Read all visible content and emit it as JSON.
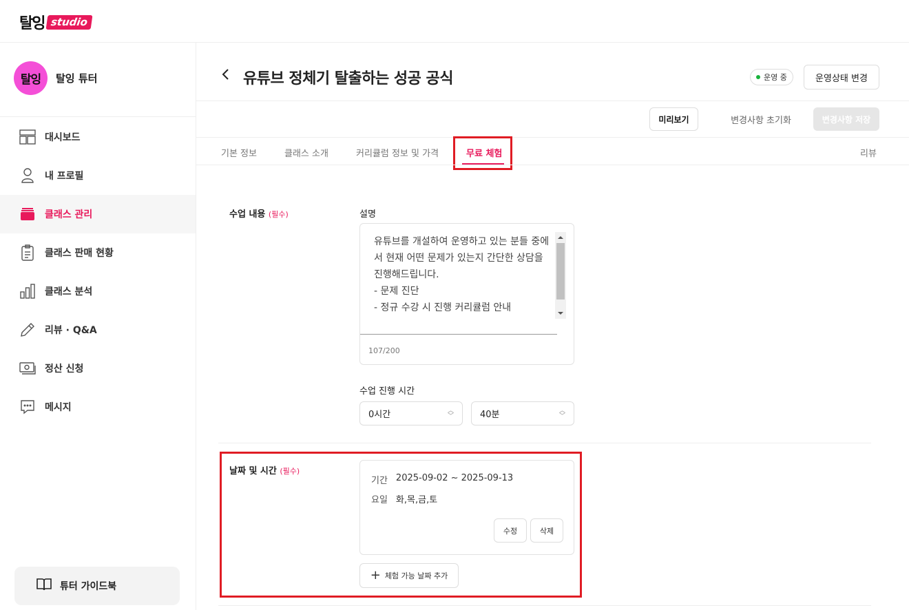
{
  "brand": {
    "logo_main": "탈잉",
    "logo_sub": "studio",
    "accent": "#e8195b"
  },
  "profile": {
    "avatar_text": "탈잉",
    "name": "탈잉 튜터"
  },
  "sidebar": {
    "items": [
      {
        "label": "대시보드",
        "icon": "dashboard-icon"
      },
      {
        "label": "내 프로필",
        "icon": "person-icon"
      },
      {
        "label": "클래스 관리",
        "icon": "class-stack-icon",
        "active": true
      },
      {
        "label": "클래스 판매 현황",
        "icon": "clipboard-icon"
      },
      {
        "label": "클래스 분석",
        "icon": "bar-chart-icon"
      },
      {
        "label": "리뷰 · Q&A",
        "icon": "pencil-icon"
      },
      {
        "label": "정산 신청",
        "icon": "money-icon"
      },
      {
        "label": "메시지",
        "icon": "chat-icon"
      }
    ],
    "guide_label": "튜터 가이드북"
  },
  "header": {
    "title": "유튜브 정체기 탈출하는 성공 공식",
    "status": "운영 중",
    "status_change": "운영상태 변경",
    "preview": "미리보기",
    "reset": "변경사항 초기화",
    "save": "변경사항 저장"
  },
  "tabs": [
    {
      "label": "기본 정보"
    },
    {
      "label": "클래스 소개"
    },
    {
      "label": "커리큘럼 정보 및 가격"
    },
    {
      "label": "무료 체험",
      "active": true
    },
    {
      "label": "리뷰"
    }
  ],
  "lesson": {
    "label": "수업 내용",
    "required": "(필수)",
    "desc_label": "설명",
    "desc_text": "유튜브를 개설하여 운영하고 있는 분들 중에서 현재 어떤 문제가 있는지 간단한 상담을 진행해드립니다.\n- 문제 진단\n- 정규 수강 시 진행 커리큘럼 안내",
    "desc_count": "107/200",
    "duration_label": "수업 진행 시간",
    "hours": "0시간",
    "minutes": "40분"
  },
  "schedule": {
    "label": "날짜 및 시간",
    "required": "(필수)",
    "period_key": "기간",
    "period_value": "2025-09-02 ~ 2025-09-13",
    "days_key": "요일",
    "days_value": "화,목,금,토",
    "edit": "수정",
    "delete": "삭제",
    "add": "체험 가능 날짜 추가"
  }
}
